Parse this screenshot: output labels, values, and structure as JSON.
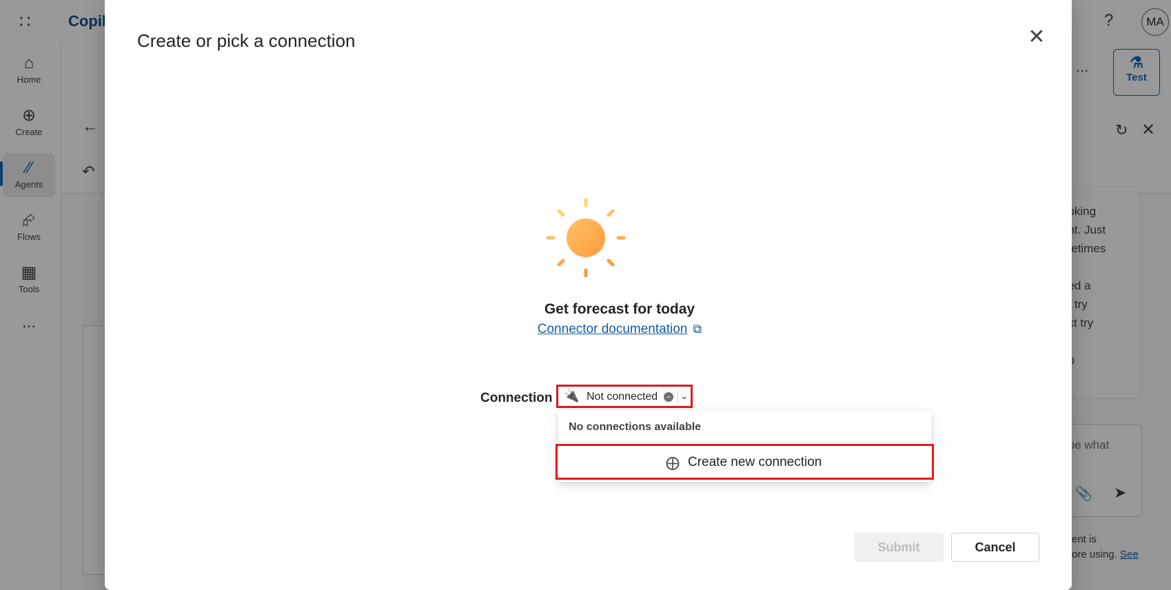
{
  "app": {
    "title_partial": "Copil",
    "avatar": "MA",
    "help": "?",
    "nav": [
      {
        "label": "Home",
        "icon": "home-icon"
      },
      {
        "label": "Create",
        "icon": "plus-circle-icon"
      },
      {
        "label": "Agents",
        "icon": "agents-icon"
      },
      {
        "label": "Flows",
        "icon": "flows-icon"
      },
      {
        "label": "Tools",
        "icon": "tools-icon"
      },
      {
        "label": "...",
        "icon": "more-icon"
      }
    ],
    "test_label": "Test",
    "more_label": "...",
    "chat_text": "ooking\nant. Just\nmetimes\n\nded a\nn, try\next try\n\nup",
    "chat_input_placeholder": "ibe what",
    "footer_text_1": "ent is",
    "footer_text_2": "ore using.",
    "footer_link": "See"
  },
  "dialog": {
    "title": "Create or pick a connection",
    "action_name": "Get forecast for today",
    "doc_link": "Connector documentation",
    "connection_label": "Connection",
    "connection_value": "Not connected",
    "menu": {
      "header": "No connections available",
      "create_label": "Create new connection"
    },
    "submit_label": "Submit",
    "cancel_label": "Cancel"
  },
  "colors": {
    "accent": "#0f6cbd",
    "highlight": "#e0191f",
    "sun": "#ffa726"
  }
}
